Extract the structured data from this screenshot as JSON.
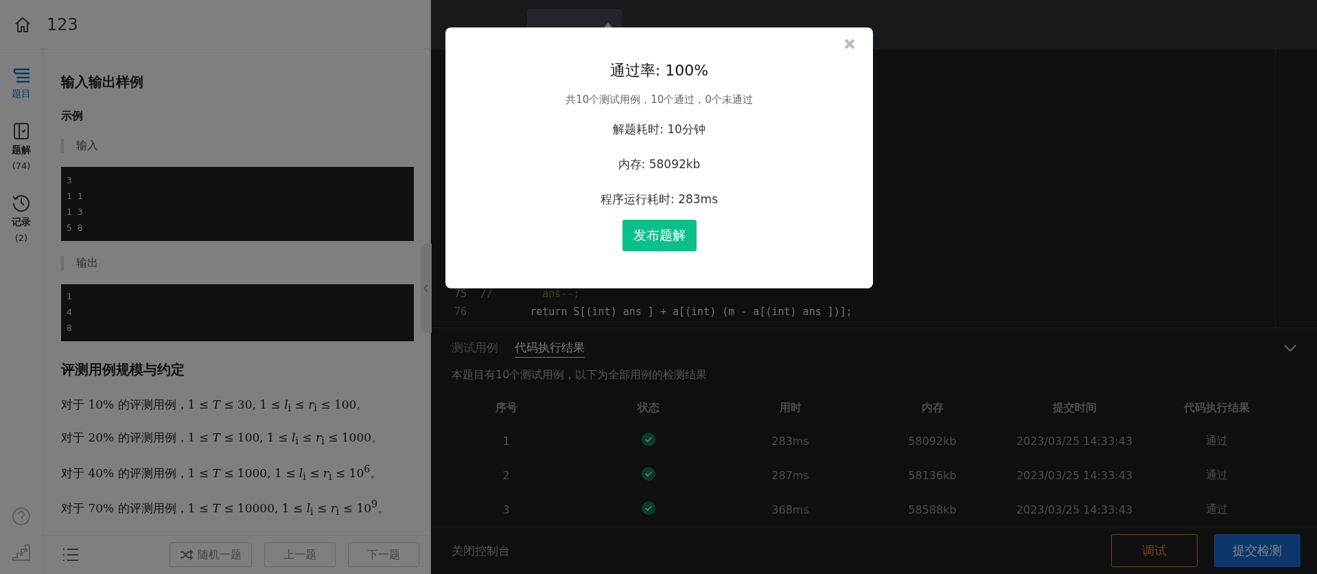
{
  "header": {
    "title": "123"
  },
  "sidebar": {
    "items": [
      {
        "kind": "list",
        "label": "题目",
        "selected": true
      },
      {
        "kind": "book",
        "label": "题解",
        "count": "(74)",
        "selected": false
      },
      {
        "kind": "history",
        "label": "记录",
        "count": "(2)",
        "selected": false
      }
    ]
  },
  "problem": {
    "sample_heading": "输入输出样例",
    "sample_label": "示例",
    "input_label": "输入",
    "input_lines": [
      "3",
      "1 1",
      "1 3",
      "5 8"
    ],
    "output_label": "输出",
    "output_lines": [
      "1",
      "4",
      "8"
    ],
    "scale_heading": "评测用例规模与约定",
    "scale_lines": [
      "对于 10% 的评测用例，1 ≤ *T* ≤ 30, 1 ≤ *l*$_{i}$ ≤ *r*$_{i}$ ≤ 100。",
      "对于 20% 的评测用例，1 ≤ *T* ≤ 100, 1 ≤ *l*$_{i}$ ≤ *r*$_{i}$ ≤ 1000。",
      "对于 40% 的评测用例，1 ≤ *T* ≤ 1000, 1 ≤ *l*$_{i}$ ≤ *r*$_{i}$ ≤ 10$^{6}$。",
      "对于 70% 的评测用例，1 ≤ *T* ≤ 10000, 1 ≤ *l*$_{i}$ ≤ *r*$_{i}$ ≤ 10$^{9}$。"
    ]
  },
  "problem_nav": {
    "buttons": [
      {
        "kind": "random",
        "label": "随机一题"
      },
      {
        "kind": "plain",
        "label": "上一题"
      },
      {
        "kind": "plain",
        "label": "下一题"
      }
    ]
  },
  "editor": {
    "lines": [
      {
        "number": "75",
        "code": "//        ans--;",
        "kind": "comment"
      },
      {
        "number": "76",
        "code": "        return S[(int) ans ] + a[(int) (m - a[(int) ans ])];",
        "kind": "code"
      }
    ]
  },
  "console": {
    "tabs": [
      {
        "label": "测试用例",
        "selected": false
      },
      {
        "label": "代码执行结果",
        "selected": true
      }
    ],
    "summary": "本题目有10个测试用例，以下为全部用例的检测结果",
    "table": {
      "columns": [
        "序号",
        "状态",
        "用时",
        "内存",
        "提交时间",
        "代码执行结果"
      ],
      "rows": [
        {
          "index": "1",
          "passed": true,
          "time": "283ms",
          "memory": "58092kb",
          "submitted": "2023/03/25 14:33:43",
          "result": "通过"
        },
        {
          "index": "2",
          "passed": true,
          "time": "287ms",
          "memory": "58136kb",
          "submitted": "2023/03/25 14:33:43",
          "result": "通过"
        },
        {
          "index": "3",
          "passed": true,
          "time": "368ms",
          "memory": "58588kb",
          "submitted": "2023/03/25 14:33:43",
          "result": "通过"
        }
      ]
    },
    "close_label": "关闭控制台",
    "buttons": [
      {
        "kind": "outline",
        "label": "调试"
      },
      {
        "kind": "primary",
        "label": "提交检测"
      }
    ]
  },
  "dialog": {
    "title": "通过率: 100%",
    "subtitle": "共10个测试用例，10个通过，0个未通过",
    "stats": [
      "解题耗时: 10分钟",
      "内存: 58092kb",
      "程序运行耗时: 283ms"
    ],
    "button": "发布题解"
  }
}
